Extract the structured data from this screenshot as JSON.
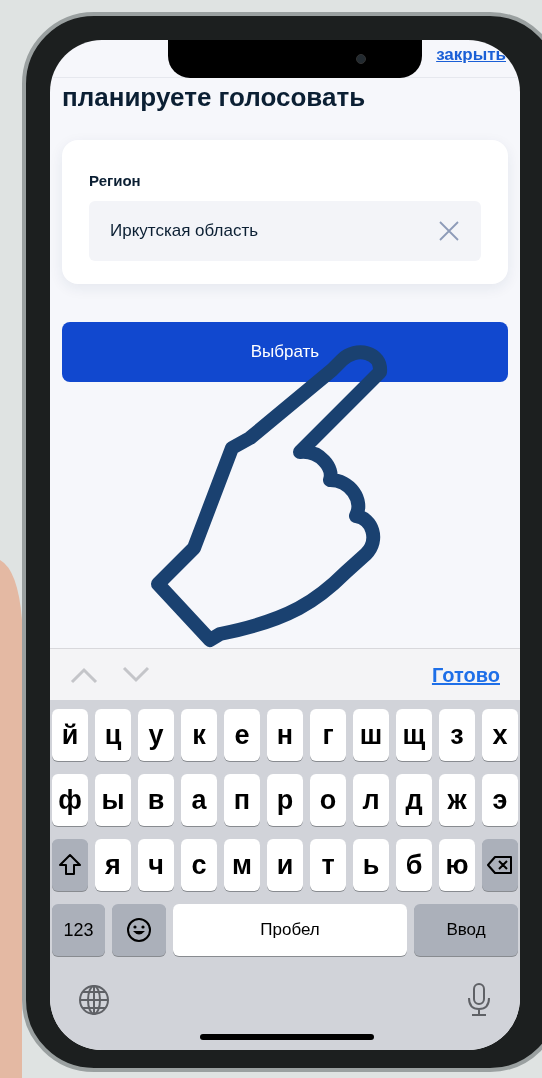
{
  "close_link": "закрыть",
  "heading": "планируете голосовать",
  "region_card": {
    "label": "Регион",
    "value": "Иркутская область"
  },
  "select_button": "Выбрать",
  "toolbar": {
    "done": "Готово"
  },
  "keyboard": {
    "rows": [
      [
        "й",
        "ц",
        "у",
        "к",
        "е",
        "н",
        "г",
        "ш",
        "щ",
        "з",
        "х"
      ],
      [
        "ф",
        "ы",
        "в",
        "а",
        "п",
        "р",
        "о",
        "л",
        "д",
        "ж",
        "э"
      ],
      [
        {
          "kind": "shift"
        },
        {
          "kind": "letter",
          "label": "я"
        },
        {
          "kind": "letter",
          "label": "ч"
        },
        {
          "kind": "letter",
          "label": "с"
        },
        {
          "kind": "letter",
          "label": "м"
        },
        {
          "kind": "letter",
          "label": "и"
        },
        {
          "kind": "letter",
          "label": "т"
        },
        {
          "kind": "letter",
          "label": "ь"
        },
        {
          "kind": "letter",
          "label": "б"
        },
        {
          "kind": "letter",
          "label": "ю"
        },
        {
          "kind": "backspace"
        }
      ]
    ],
    "numbers_key": "123",
    "space_key": "Пробел",
    "enter_key": "Ввод"
  }
}
